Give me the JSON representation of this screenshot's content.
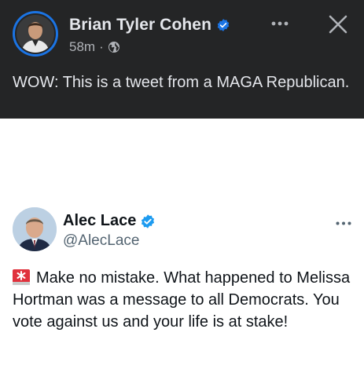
{
  "facebook_post": {
    "author": "Brian Tyler Cohen",
    "time": "58m",
    "separator": "·",
    "text": "WOW: This is a tweet from a MAGA Republican.",
    "icons": {
      "verified": "verified-badge-icon",
      "audience": "globe-icon",
      "more": "more-options-icon",
      "close": "close-icon"
    },
    "colors": {
      "background": "#242526",
      "accent": "#1b74e4"
    }
  },
  "tweet": {
    "author": "Alec Lace",
    "handle": "@AlecLace",
    "text": "Make no mistake.  What happened to Melissa Hortman was a message to all Democrats.  You vote against us and your life is at stake!",
    "icons": {
      "verified": "verified-badge-icon",
      "siren": "rotating-light-emoji",
      "more": "more-options-icon"
    },
    "colors": {
      "verified": "#1d9bf0"
    }
  }
}
